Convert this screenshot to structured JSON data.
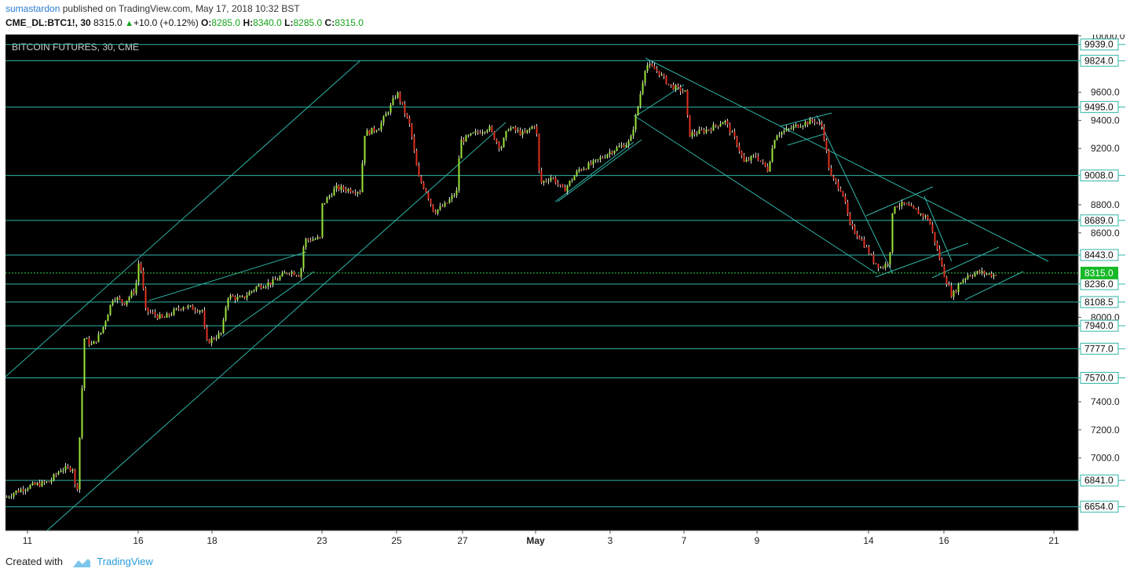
{
  "header": {
    "author": "sumastardon",
    "published_text": "published on TradingView.com, May 17, 2018 10:32 BST",
    "symbol": "CME_DL:BTC1!, 30",
    "last": "8315.0",
    "change_arrow": "▲",
    "change": "+10.0 (+0.12%)",
    "o_label": "O:",
    "o_value": "8285.0",
    "h_label": "H:",
    "h_value": "8340.0",
    "l_label": "L:",
    "l_value": "8285.0",
    "c_label": "C:",
    "c_value": "8315.0"
  },
  "footer": {
    "created_with": "Created with",
    "brand": "TradingView"
  },
  "chart_data": {
    "type": "candlestick",
    "title": "BITCOIN FUTURES, 30, CME",
    "ylim": [
      6485,
      10010
    ],
    "y_ticks": [
      {
        "label": "10000.0",
        "value": 10000
      },
      {
        "label": "9600.0",
        "value": 9600
      },
      {
        "label": "9400.0",
        "value": 9400
      },
      {
        "label": "9200.0",
        "value": 9200
      },
      {
        "label": "8800.0",
        "value": 8800
      },
      {
        "label": "8600.0",
        "value": 8600
      },
      {
        "label": "8000.0",
        "value": 8000
      },
      {
        "label": "7400.0",
        "value": 7400
      },
      {
        "label": "7200.0",
        "value": 7200
      },
      {
        "label": "7000.0",
        "value": 7000
      }
    ],
    "x_ticks": [
      {
        "label": "11",
        "pos": 28
      },
      {
        "label": "16",
        "pos": 169
      },
      {
        "label": "18",
        "pos": 263
      },
      {
        "label": "23",
        "pos": 403
      },
      {
        "label": "25",
        "pos": 498
      },
      {
        "label": "27",
        "pos": 582
      },
      {
        "label": "May",
        "pos": 675
      },
      {
        "label": "3",
        "pos": 770
      },
      {
        "label": "7",
        "pos": 864
      },
      {
        "label": "9",
        "pos": 957
      },
      {
        "label": "14",
        "pos": 1099
      },
      {
        "label": "16",
        "pos": 1195
      },
      {
        "label": "21",
        "pos": 1335
      }
    ],
    "levels": [
      {
        "label": "9939.0",
        "value": 9939
      },
      {
        "label": "9824.0",
        "value": 9824
      },
      {
        "label": "9495.0",
        "value": 9495
      },
      {
        "label": "9008.0",
        "value": 9008
      },
      {
        "label": "8689.0",
        "value": 8689
      },
      {
        "label": "8443.0",
        "value": 8443
      },
      {
        "label": "8236.0",
        "value": 8236
      },
      {
        "label": "8108.5",
        "value": 8108.5
      },
      {
        "label": "7940.0",
        "value": 7940
      },
      {
        "label": "7777.0",
        "value": 7777
      },
      {
        "label": "7570.0",
        "value": 7570
      },
      {
        "label": "6841.0",
        "value": 6841
      },
      {
        "label": "6654.0",
        "value": 6654
      }
    ],
    "current_price": {
      "label": "8315.0",
      "value": 8315
    },
    "path": [
      [
        0,
        6720
      ],
      [
        12,
        6760
      ],
      [
        30,
        6800
      ],
      [
        55,
        6830
      ],
      [
        70,
        6920
      ],
      [
        86,
        6930
      ],
      [
        90,
        6680
      ],
      [
        100,
        7850
      ],
      [
        110,
        7800
      ],
      [
        122,
        7900
      ],
      [
        137,
        8150
      ],
      [
        150,
        8100
      ],
      [
        165,
        8200
      ],
      [
        170,
        8430
      ],
      [
        178,
        8050
      ],
      [
        200,
        7990
      ],
      [
        225,
        8080
      ],
      [
        250,
        8050
      ],
      [
        255,
        7820
      ],
      [
        275,
        7890
      ],
      [
        282,
        8150
      ],
      [
        300,
        8130
      ],
      [
        320,
        8220
      ],
      [
        340,
        8250
      ],
      [
        360,
        8330
      ],
      [
        375,
        8300
      ],
      [
        380,
        8550
      ],
      [
        400,
        8560
      ],
      [
        403,
        8800
      ],
      [
        420,
        8920
      ],
      [
        445,
        8900
      ],
      [
        453,
        8900
      ],
      [
        455,
        9300
      ],
      [
        475,
        9350
      ],
      [
        490,
        9500
      ],
      [
        498,
        9600
      ],
      [
        505,
        9500
      ],
      [
        515,
        9350
      ],
      [
        525,
        9000
      ],
      [
        535,
        8900
      ],
      [
        545,
        8750
      ],
      [
        560,
        8800
      ],
      [
        575,
        8900
      ],
      [
        578,
        9250
      ],
      [
        595,
        9300
      ],
      [
        615,
        9350
      ],
      [
        630,
        9200
      ],
      [
        640,
        9350
      ],
      [
        660,
        9300
      ],
      [
        675,
        9380
      ],
      [
        680,
        8950
      ],
      [
        695,
        9000
      ],
      [
        710,
        8900
      ],
      [
        730,
        9050
      ],
      [
        750,
        9100
      ],
      [
        770,
        9180
      ],
      [
        795,
        9250
      ],
      [
        805,
        9500
      ],
      [
        815,
        9800
      ],
      [
        830,
        9750
      ],
      [
        845,
        9650
      ],
      [
        865,
        9600
      ],
      [
        870,
        9300
      ],
      [
        885,
        9320
      ],
      [
        900,
        9350
      ],
      [
        915,
        9400
      ],
      [
        930,
        9250
      ],
      [
        940,
        9100
      ],
      [
        955,
        9150
      ],
      [
        970,
        9050
      ],
      [
        980,
        9300
      ],
      [
        995,
        9330
      ],
      [
        1010,
        9370
      ],
      [
        1030,
        9400
      ],
      [
        1040,
        9350
      ],
      [
        1050,
        9000
      ],
      [
        1065,
        8900
      ],
      [
        1075,
        8650
      ],
      [
        1090,
        8550
      ],
      [
        1105,
        8400
      ],
      [
        1115,
        8350
      ],
      [
        1125,
        8400
      ],
      [
        1130,
        8800
      ],
      [
        1145,
        8800
      ],
      [
        1160,
        8750
      ],
      [
        1175,
        8700
      ],
      [
        1185,
        8500
      ],
      [
        1195,
        8300
      ],
      [
        1205,
        8150
      ],
      [
        1215,
        8250
      ],
      [
        1225,
        8300
      ],
      [
        1240,
        8320
      ],
      [
        1258,
        8300
      ],
      [
        1262,
        8315
      ]
    ]
  }
}
